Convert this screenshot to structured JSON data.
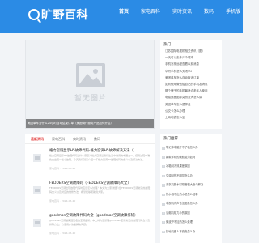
{
  "header": {
    "logo_text": "旷野百科",
    "nav": [
      "首页",
      "家电百科",
      "实时资讯",
      "数码",
      "手机版"
    ]
  },
  "slider": {
    "placeholder": "暂无图片",
    "caption": "美团单车为什么24小时自动结束订单（美团骑行服务产品如何开启）"
  },
  "side": {
    "title": "热门",
    "items": [
      "江苏国际电视机相关资讯（图）",
      "一天可以去多少个城市",
      "手机怎样远程查看以前消息",
      "华为手机怎么关闭5G",
      "美团单车怎么自动取消订单",
      "如何使用微信给自己的手机发消息",
      "哪个牌子的手机最适合老年人使用",
      "电脑桌面图标突然变大怎么调",
      "美团单车怎么退押金",
      "公交卡怎么办理",
      "上海地铁怎么坐"
    ]
  },
  "main": {
    "tabs": [
      "最新资讯",
      "家电百科",
      "实时资讯",
      "数码"
    ],
    "articles": [
      {
        "title": "格力空调显示H5故障代码-格力空调H5故障解决方法（ ...",
        "summary": "格力空调显示H5故障代码是什么意思？格力空调是我们生活中常用的电器之一，使用过程中难免会出现一些小故障，今天我们就来介绍一下格力空调H5故障代码的含义以及解决方法。",
        "meta": "家电百科 · 2024-05-20"
      },
      {
        "title": "FEDDERS空调故障码（FEDDERS空调故障码大全）",
        "summary": "FEDDERS空调出现故障代码时应该怎么处理？本文为大家详细介绍FEDDERS空调常见的故障码含义以及对应的维修方法，希望能够帮助到大家。",
        "meta": "家电百科 · 2024-05-20"
      },
      {
        "title": "goodman空调故障代码大全（goodman空调故障排除）",
        "summary": "goodman空调是美国知名的空调品牌，本文将为您整理goodman空调常见的故障代码含义及排除方法，方便用户快速解决问题。",
        "meta": "家电百科 · 2024-05-20"
      }
    ]
  },
  "hot": {
    "title": "热门推荐",
    "items": [
      "笔记本电脑开不了机怎么办",
      "新款手机的续航能力如何",
      "冰箱制冷效果差原因",
      "空调制热不明显怎么办",
      "洗衣机脱水时噪音很大怎么解决",
      "热水器不出热水是怎么回事",
      "电视机有声音没图像怎么办",
      "油烟机吸力小的原因",
      "微波炉不加热怎么处理",
      "扫地机器人不充电怎么办"
    ]
  }
}
